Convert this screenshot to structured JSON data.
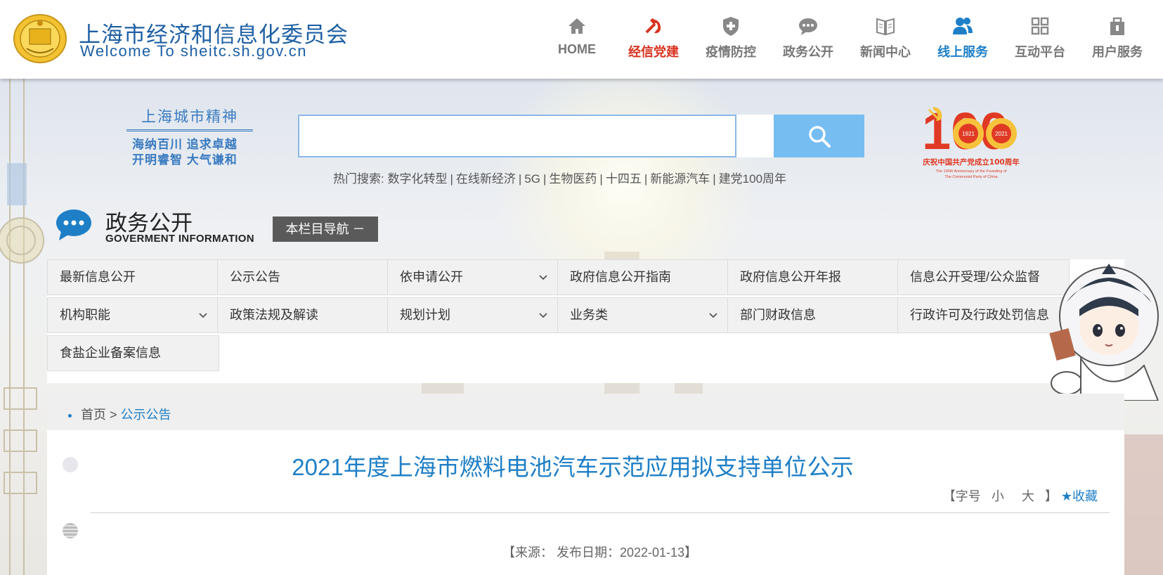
{
  "header": {
    "site_name_cn": "上海市经济和信息化委员会",
    "site_name_en": "Welcome To sheitc.sh.gov.cn",
    "nav": [
      {
        "label": "HOME",
        "icon": "home-icon"
      },
      {
        "label": "经信党建",
        "icon": "hammer-sickle-icon"
      },
      {
        "label": "疫情防控",
        "icon": "shield-icon"
      },
      {
        "label": "政务公开",
        "icon": "chat-bubble-icon"
      },
      {
        "label": "新闻中心",
        "icon": "book-icon"
      },
      {
        "label": "线上服务",
        "icon": "users-icon"
      },
      {
        "label": "互动平台",
        "icon": "grid-icon"
      },
      {
        "label": "用户服务",
        "icon": "briefcase-icon"
      }
    ],
    "colors": {
      "brand": "#1d5fa3",
      "active_red": "#d9321f",
      "active_blue": "#1e7fc7"
    }
  },
  "spirit": {
    "title": "上海城市精神",
    "line1": "海纳百川 追求卓越",
    "line2": "开明睿智 大气谦和"
  },
  "search": {
    "value": "",
    "placeholder": "",
    "hot_prefix": "热门搜索:",
    "hot_items": [
      "数字化转型",
      "在线新经济",
      "5G",
      "生物医药",
      "十四五",
      "新能源汽车",
      "建党100周年"
    ]
  },
  "badge": {
    "number": "100",
    "year_left": "1921",
    "year_right": "2021",
    "caption_cn": "庆祝中国共产党成立100周年",
    "caption_en1": "The 100th Anniversary of the Founding of",
    "caption_en2": "The Communist Party of China"
  },
  "section": {
    "title": "政务公开",
    "subtitle": "GOVERMENT INFORMATION",
    "nav_button": "本栏目导航 －"
  },
  "categories": [
    {
      "label": "最新信息公开",
      "dropdown": false
    },
    {
      "label": "公示公告",
      "dropdown": false
    },
    {
      "label": "依申请公开",
      "dropdown": true
    },
    {
      "label": "政府信息公开指南",
      "dropdown": false
    },
    {
      "label": "政府信息公开年报",
      "dropdown": false
    },
    {
      "label": "信息公开受理/公众监督",
      "dropdown": false
    },
    {
      "label": "机构职能",
      "dropdown": true
    },
    {
      "label": "政策法规及解读",
      "dropdown": false
    },
    {
      "label": "规划计划",
      "dropdown": true
    },
    {
      "label": "业务类",
      "dropdown": true
    },
    {
      "label": "部门财政信息",
      "dropdown": false
    },
    {
      "label": "行政许可及行政处罚信息",
      "dropdown": false
    },
    {
      "label": "食盐企业备案信息",
      "dropdown": false
    }
  ],
  "breadcrumb": {
    "home": "首页",
    "separator": ">",
    "current": "公示公告"
  },
  "article": {
    "title": "2021年度上海市燃料电池汽车示范应用拟支持单位公示",
    "font_label": "【字号",
    "font_small": "小",
    "font_large": "大",
    "font_close": "】",
    "favorite": "★收藏",
    "meta": "【来源： 发布日期：2022-01-13】"
  }
}
